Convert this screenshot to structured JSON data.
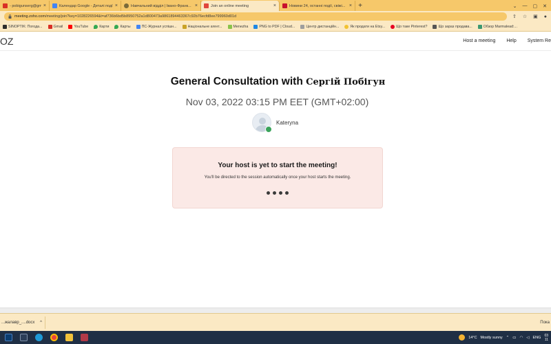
{
  "browser": {
    "tabs": [
      {
        "label": "- pobigunserg@gmail..",
        "color": "#d93025",
        "active": false
      },
      {
        "label": "Календар Google - Деталі події",
        "color": "#4285f4",
        "active": false
      },
      {
        "label": "Навчальний відділ | Івано-Франк...",
        "color": "#7a6a3a",
        "active": false
      },
      {
        "label": "Join an online meeting",
        "color": "#e0463c",
        "active": true
      },
      {
        "label": "Новини 24, останні події, свіжі...",
        "color": "#c8102e",
        "active": false
      }
    ],
    "new_tab_label": "+",
    "url_host": "meeting.zoho.com",
    "url_path": "/meeting/join?key=1028226594&t=af736b6bd5b8950752a1d800473a9861894463367c92b76ecfd8ee799960d01d",
    "bookmarks": [
      {
        "label": "SINOPTIK: Погода...",
        "color": "#2d2d2d"
      },
      {
        "label": "Gmail",
        "color": "#d93025"
      },
      {
        "label": "YouTube",
        "color": "#ff0000"
      },
      {
        "label": "Карти",
        "color": "#34a853"
      },
      {
        "label": "Карты",
        "color": "#34a853"
      },
      {
        "label": "ПС-Журнал успішн...",
        "color": "#4285f4"
      },
      {
        "label": "Національне агент...",
        "color": "#c9a227"
      },
      {
        "label": "Menezha",
        "color": "#8bc34a"
      },
      {
        "label": "PNG to PDF | Cloud...",
        "color": "#1e88e5"
      },
      {
        "label": "Центр дистанційн...",
        "color": "#9e9e9e"
      },
      {
        "label": "Як продати на Etsy...",
        "color": "#f1c232"
      },
      {
        "label": "Що таке Pinterest?",
        "color": "#e60023"
      },
      {
        "label": "Що зараз продава...",
        "color": "#555555"
      },
      {
        "label": "Обзор Marmalead:...",
        "color": "#3d9970"
      }
    ]
  },
  "app": {
    "logo": "OZ",
    "nav": [
      "Host a meeting",
      "Help",
      "System Re"
    ]
  },
  "meeting": {
    "title_prefix": "General Consultation with",
    "host_full_name": "Сергій Побігун",
    "datetime": "Nov 03, 2022 03:15 PM EET (GMT+02:00)",
    "participant_name": "Kateryna"
  },
  "notice": {
    "title": "Your host is yet to start the meeting!",
    "subtitle": "You'll be directed to the session automatically once your host starts the meeting."
  },
  "downloads": {
    "file_name": "...жалавр_....docx",
    "show_all": "Пока"
  },
  "taskbar": {
    "weather_temp": "14°C",
    "weather_text": "Mostly sunny",
    "lang": "ENG",
    "time": "03",
    "date": "11"
  }
}
